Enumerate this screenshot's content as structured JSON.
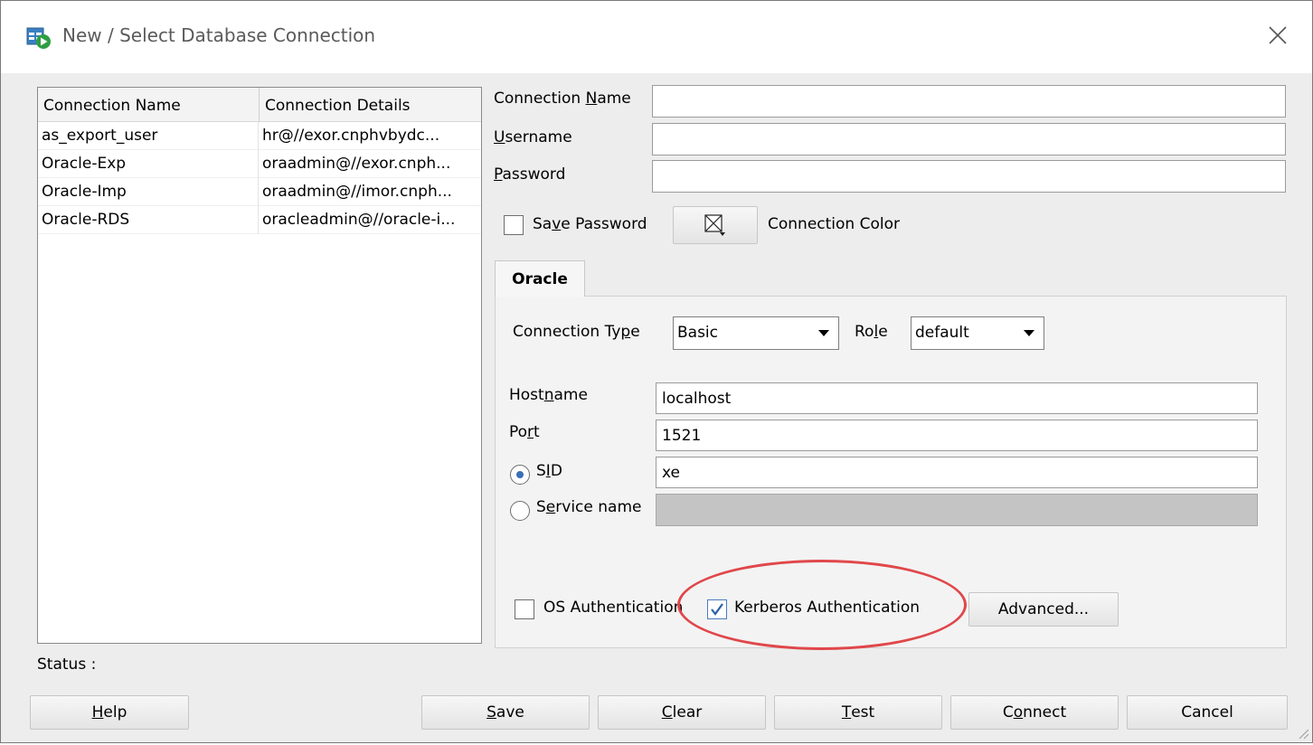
{
  "window": {
    "title": "New / Select Database Connection",
    "icons": {
      "app": "database-connection-icon",
      "close": "close-icon"
    }
  },
  "connections_table": {
    "columns": [
      "Connection Name",
      "Connection Details"
    ],
    "rows": [
      {
        "name": "as_export_user",
        "details": "hr@//exor.cnphvbydc..."
      },
      {
        "name": "Oracle-Exp",
        "details": "oraadmin@//exor.cnph..."
      },
      {
        "name": "Oracle-Imp",
        "details": "oraadmin@//imor.cnph..."
      },
      {
        "name": "Oracle-RDS",
        "details": "oracleadmin@//oracle-i..."
      }
    ]
  },
  "form": {
    "connection_name": {
      "label_pre": "Connection ",
      "label_u": "N",
      "label_post": "ame",
      "value": ""
    },
    "username": {
      "label_pre": "",
      "label_u": "U",
      "label_post": "sername",
      "value": ""
    },
    "password": {
      "label_pre": "",
      "label_u": "P",
      "label_post": "assword",
      "value": ""
    },
    "save_password": {
      "label_pre": "Sa",
      "label_u": "v",
      "label_post": "e Password",
      "checked": false
    },
    "connection_color": {
      "label": "Connection Color",
      "icon": "color-picker-icon"
    }
  },
  "tabs": [
    {
      "label": "Oracle",
      "active": true
    }
  ],
  "oracle": {
    "connection_type": {
      "label_pre": "Connection Ty",
      "label_u": "p",
      "label_post": "e",
      "value": "Basic"
    },
    "role": {
      "label_pre": "Ro",
      "label_u": "l",
      "label_post": "e",
      "value": "default"
    },
    "hostname": {
      "label_pre": "Host",
      "label_u": "n",
      "label_post": "ame",
      "value": "localhost"
    },
    "port": {
      "label_pre": "Po",
      "label_u": "r",
      "label_post": "t",
      "value": "1521"
    },
    "sid": {
      "label_pre": "S",
      "label_u": "I",
      "label_post": "D",
      "value": "xe",
      "selected": true
    },
    "service_name": {
      "label_pre": "S",
      "label_u": "e",
      "label_post": "rvice name",
      "value": "",
      "selected": false
    },
    "os_auth": {
      "label": "OS Authentication",
      "checked": false
    },
    "kerberos_auth": {
      "label": "Kerberos Authentication",
      "checked": true
    },
    "advanced_button": "Advanced...",
    "highlight_color": "#e0474a"
  },
  "status": {
    "label": "Status :",
    "value": ""
  },
  "buttons": {
    "help": {
      "pre": "",
      "u": "H",
      "post": "elp"
    },
    "save": {
      "pre": "",
      "u": "S",
      "post": "ave"
    },
    "clear": {
      "pre": "",
      "u": "C",
      "post": "lear"
    },
    "test": {
      "pre": "",
      "u": "T",
      "post": "est"
    },
    "connect": {
      "pre": "C",
      "u": "o",
      "post": "nnect"
    },
    "cancel": {
      "pre": "Cancel",
      "u": "",
      "post": ""
    }
  }
}
